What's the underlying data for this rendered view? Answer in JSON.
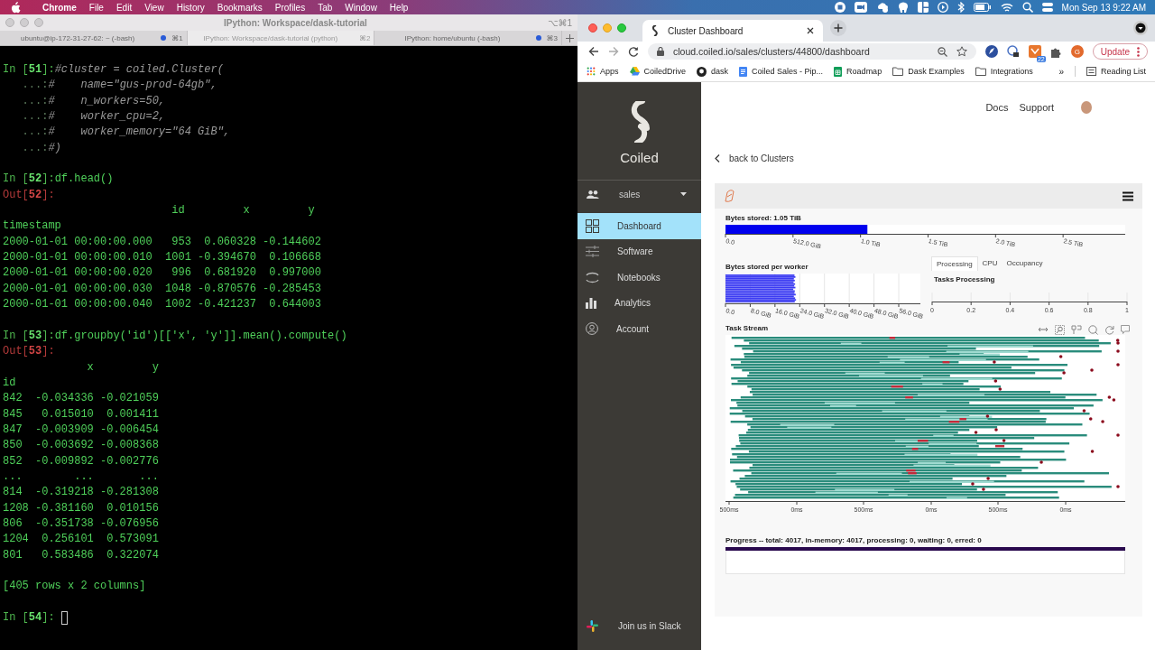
{
  "menubar": {
    "app": "Chrome",
    "menus": [
      "File",
      "Edit",
      "View",
      "History",
      "Bookmarks",
      "Profiles",
      "Tab",
      "Window",
      "Help"
    ],
    "clock": "Mon Sep 13  9:22 AM"
  },
  "terminal": {
    "title": "IPython: Workspace/dask-tutorial",
    "shortcut": "⌥⌘1",
    "tabs": [
      {
        "label": "ubuntu@ip-172-31-27-62: ~ (-bash)",
        "shortcut": "⌘1",
        "activity": true,
        "selected": false
      },
      {
        "label": "IPython: Workspace/dask-tutorial (python)",
        "shortcut": "⌘2",
        "activity": false,
        "selected": true
      },
      {
        "label": "IPython: home/ubuntu (-bash)",
        "shortcut": "⌘3",
        "activity": true,
        "selected": false
      }
    ],
    "lines": [
      {
        "kind": "input",
        "prompt": "In [**51**]:",
        "code": "#cluster = coiled.Cluster("
      },
      {
        "kind": "continuation",
        "prompt": "   ...:",
        "code": "#    name=\"gus-prod-64gb\","
      },
      {
        "kind": "continuation",
        "prompt": "   ...:",
        "code": "#    n_workers=50,"
      },
      {
        "kind": "continuation",
        "prompt": "   ...:",
        "code": "#    worker_cpu=2,"
      },
      {
        "kind": "continuation",
        "prompt": "   ...:",
        "code": "#    worker_memory=\"64 GiB\","
      },
      {
        "kind": "continuation",
        "prompt": "   ...:",
        "code": "#)"
      },
      {
        "kind": "blank"
      },
      {
        "kind": "input",
        "prompt": "In [**52**]:",
        "code": "df.head()"
      },
      {
        "kind": "out",
        "prompt": "Out[**52**]:"
      },
      {
        "kind": "text",
        "text": "                          id         x         y"
      },
      {
        "kind": "text",
        "text": "timestamp"
      },
      {
        "kind": "text",
        "text": "2000-01-01 00:00:00.000   953  0.060328 -0.144602"
      },
      {
        "kind": "text",
        "text": "2000-01-01 00:00:00.010  1001 -0.394670  0.106668"
      },
      {
        "kind": "text",
        "text": "2000-01-01 00:00:00.020   996  0.681920  0.997000"
      },
      {
        "kind": "text",
        "text": "2000-01-01 00:00:00.030  1048 -0.870576 -0.285453"
      },
      {
        "kind": "text",
        "text": "2000-01-01 00:00:00.040  1002 -0.421237  0.644003"
      },
      {
        "kind": "blank"
      },
      {
        "kind": "input",
        "prompt": "In [**53**]:",
        "code": "df.groupby('id')[['x', 'y']].mean().compute()"
      },
      {
        "kind": "out",
        "prompt": "Out[**53**]:"
      },
      {
        "kind": "text",
        "text": "             x         y"
      },
      {
        "kind": "text",
        "text": "id"
      },
      {
        "kind": "text",
        "text": "842  -0.034336 -0.021059"
      },
      {
        "kind": "text",
        "text": "845   0.015010  0.001411"
      },
      {
        "kind": "text",
        "text": "847  -0.003909 -0.006454"
      },
      {
        "kind": "text",
        "text": "850  -0.003692 -0.008368"
      },
      {
        "kind": "text",
        "text": "852  -0.009892 -0.002776"
      },
      {
        "kind": "text",
        "text": "...        ...       ..."
      },
      {
        "kind": "text",
        "text": "814  -0.319218 -0.281308"
      },
      {
        "kind": "text",
        "text": "1208 -0.381160  0.010156"
      },
      {
        "kind": "text",
        "text": "806  -0.351738 -0.076956"
      },
      {
        "kind": "text",
        "text": "1204  0.256101  0.573091"
      },
      {
        "kind": "text",
        "text": "801   0.583486  0.322074"
      },
      {
        "kind": "blank"
      },
      {
        "kind": "text",
        "text": "[405 rows x 2 columns]"
      },
      {
        "kind": "blank"
      },
      {
        "kind": "input",
        "prompt": "In [**54**]:",
        "cursor": true
      }
    ]
  },
  "browser": {
    "tab_title": "Cluster Dashboard",
    "url": "cloud.coiled.io/sales/clusters/44800/dashboard",
    "extension_badge": "22",
    "profile_initial": "G",
    "update_label": "Update",
    "bookmarks": [
      {
        "label": "Apps",
        "kind": "apps"
      },
      {
        "label": "CoiledDrive",
        "kind": "drive"
      },
      {
        "label": "dask",
        "kind": "github"
      },
      {
        "label": "Coiled Sales - Pip...",
        "kind": "doc"
      },
      {
        "label": "Roadmap",
        "kind": "sheet"
      },
      {
        "label": "Dask Examples",
        "kind": "folder"
      },
      {
        "label": "Integrations",
        "kind": "folder"
      }
    ],
    "more": "»",
    "reading_list": "Reading List"
  },
  "sidebar": {
    "brand": "Coiled",
    "team": "sales",
    "items": [
      {
        "label": "Dashboard",
        "kind": "dashboard",
        "selected": true
      },
      {
        "label": "Software",
        "kind": "software",
        "selected": false
      },
      {
        "label": "Notebooks",
        "kind": "notebooks",
        "selected": false
      },
      {
        "label": "Analytics",
        "kind": "analytics",
        "selected": false
      },
      {
        "label": "Account",
        "kind": "account",
        "selected": false
      }
    ],
    "slack": "Join us in Slack"
  },
  "header": {
    "links": [
      "Docs",
      "Support"
    ]
  },
  "back_link": "back to Clusters",
  "dashboard": {
    "bytes_stored": {
      "title": "Bytes stored: 1.05 TiB",
      "level": 0.355,
      "tick_labels": [
        "0.0",
        "512.0 GiB",
        "1.0 TiB",
        "1.5 TiB",
        "2.0 TiB",
        "2.5 TiB"
      ]
    },
    "per_worker": {
      "title": "Bytes stored per worker",
      "tick_labels": [
        "0.0",
        "8.0 GiB",
        "16.0 GiB",
        "24.0 GiB",
        "32.0 GiB",
        "40.0 GiB",
        "48.0 GiB",
        "56.0 GiB"
      ]
    },
    "tabs": [
      {
        "label": "Processing",
        "selected": true
      },
      {
        "label": "CPU",
        "selected": false
      },
      {
        "label": "Occupancy",
        "selected": false
      }
    ],
    "tasks_processing": {
      "title": "Tasks Processing",
      "tick_labels": [
        "0",
        "0.2",
        "0.4",
        "0.6",
        "0.8",
        "1"
      ]
    },
    "task_stream": {
      "title": "Task Stream",
      "tick_labels": [
        "500ms",
        "0ms",
        "500ms",
        "0ms",
        "500ms",
        "0ms"
      ]
    },
    "progress": {
      "text": "Progress -- total: 4017, in-memory: 4017, processing: 0, waiting: 0, erred: 0",
      "level": 1
    }
  }
}
